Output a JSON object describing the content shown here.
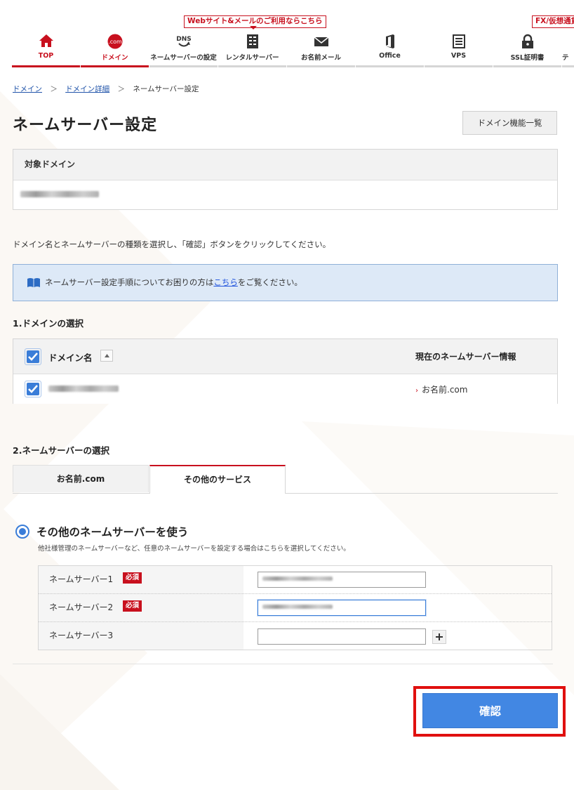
{
  "promo": {
    "web_label": "Webサイト&メールのご利用ならこちら",
    "fx_label": "FX/仮想通貨"
  },
  "nav": {
    "items": [
      {
        "label": "TOP",
        "icon": "home-icon"
      },
      {
        "label": "ドメイン",
        "icon": "dotcom-icon"
      },
      {
        "label": "ネームサーバーの設定",
        "icon": "dns-icon"
      },
      {
        "label": "レンタルサーバー",
        "icon": "server-icon"
      },
      {
        "label": "お名前メール",
        "icon": "mail-icon"
      },
      {
        "label": "Office",
        "icon": "office-icon"
      },
      {
        "label": "VPS",
        "icon": "vps-icon"
      },
      {
        "label": "SSL証明書",
        "icon": "lock-icon"
      }
    ],
    "dotcom_text": ".com",
    "dns_text": "DNS",
    "active_color": "#c8101e"
  },
  "breadcrumb": [
    "ドメイン",
    "ドメイン詳細",
    "ネームサーバー設定"
  ],
  "breadcrumb_sep": "＞",
  "title": "ネームサーバー設定",
  "feature_button": "ドメイン機能一覧",
  "target_domain": {
    "header": "対象ドメイン"
  },
  "instruction": "ドメイン名とネームサーバーの種類を選択し、「確認」ボタンをクリックしてください。",
  "info": {
    "before": "ネームサーバー設定手順についてお困りの方は",
    "link": "こちら",
    "after": "をご覧ください。"
  },
  "section1": "1.ドメインの選択",
  "domain_table": {
    "col_name": "ドメイン名",
    "col_ns": "現在のネームサーバー情報",
    "rows": [
      {
        "ns": "お名前.com",
        "checked": true
      }
    ]
  },
  "section2": "2.ネームサーバーの選択",
  "tabs": [
    "お名前.com",
    "その他のサービス"
  ],
  "other_option": {
    "title": "その他のネームサーバーを使う",
    "desc": "他社様管理のネームサーバーなど、任意のネームサーバーを設定する場合はこちらを選択してください。"
  },
  "nameservers": [
    {
      "label": "ネームサーバー1",
      "required": "必須"
    },
    {
      "label": "ネームサーバー2",
      "required": "必須"
    },
    {
      "label": "ネームサーバー3",
      "required": ""
    }
  ],
  "confirm": "確認",
  "colors": {
    "brand_red": "#c8101e",
    "primary_blue": "#4287e3",
    "info_bg": "#dde9f7",
    "highlight_frame": "#e0100f"
  }
}
